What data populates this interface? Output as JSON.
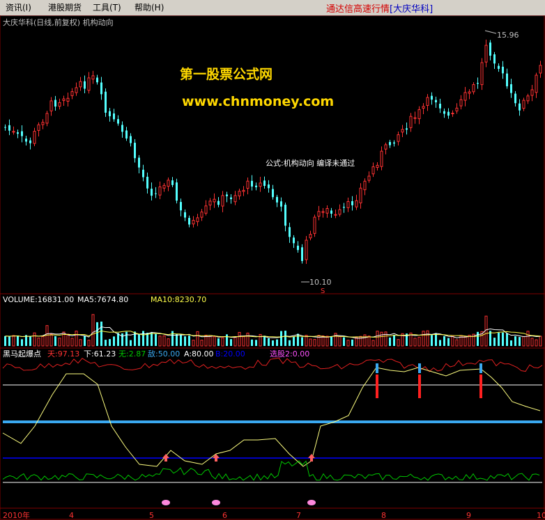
{
  "menu": {
    "items": [
      "资讯(I)",
      "港股期货",
      "工具(T)",
      "帮助(H)"
    ]
  },
  "market": {
    "title": "通达信高速行情",
    "stock_tag": "[大庆华科]"
  },
  "price_panel": {
    "title": "大庆华科(日线,前复权) 机构动向",
    "formula_error": "公式:机构动向 编译未通过",
    "high_label": "15.96",
    "low_label": "10.10",
    "s_marker": "S",
    "watermark_cn": "第一股票公式网",
    "watermark_url": "www.chnmoney.com"
  },
  "volume_panel": {
    "label": "VOLUME:16831.00",
    "ma5": "MA5:7674.80",
    "ma10": "MA10:8230.70"
  },
  "indicator_panel": {
    "name": "黑马起爆点",
    "tian": "天:97.13",
    "xia": "下:61.23",
    "wu": "无:2.87",
    "di": "敌:50.00",
    "a": "A:80.00",
    "b": "B:20.00",
    "xuangu": "选股2:0.00"
  },
  "date_axis": {
    "labels": [
      "2010年",
      "4",
      "5",
      "6",
      "7",
      "8",
      "9",
      "10"
    ]
  },
  "colors": {
    "up": "#ff3232",
    "down": "#54ffff",
    "ma_white": "#ffffff",
    "ma_yellow": "#ffff4a",
    "thick_blue": "#3aa8f0",
    "navy": "#0000ff",
    "green": "#00c800",
    "watermark": "#ffd800"
  }
}
